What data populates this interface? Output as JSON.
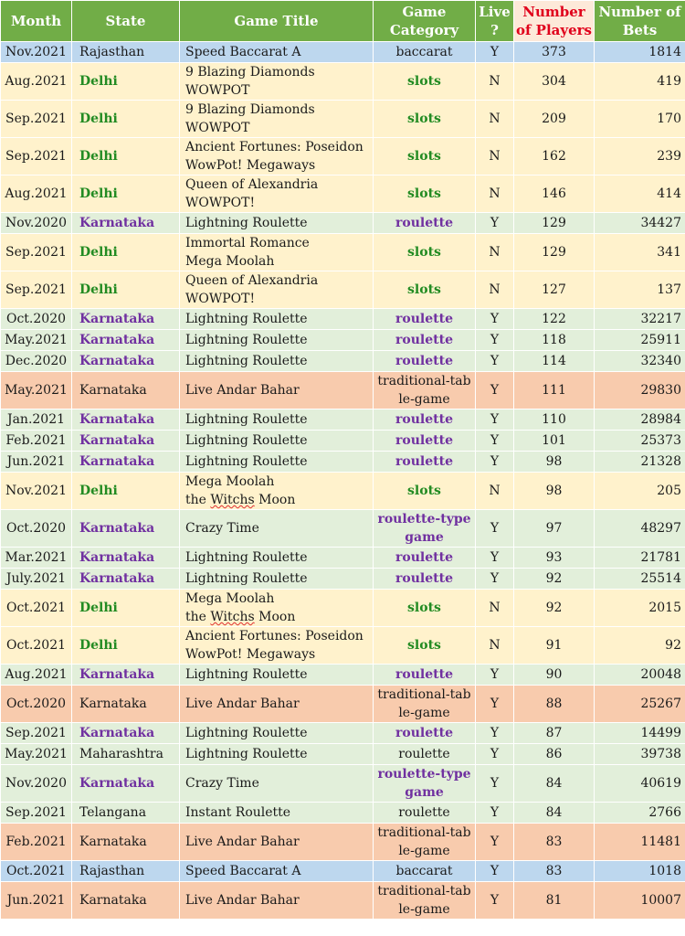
{
  "headers": {
    "month": "Month",
    "state": "State",
    "title": "Game Title",
    "category": "Game Category",
    "live": "Live ?",
    "players": "Number of Players",
    "bets": "Number of Bets"
  },
  "colors": {
    "header_bg": "#71ad47",
    "highlight_header_bg": "#fde9d9",
    "highlight_header_text": "#e0001b",
    "row_blue": "#bdd7ee",
    "row_yellow": "#fff2cc",
    "row_green": "#e2efda",
    "row_orange": "#f8cbad",
    "text_green": "#228b22",
    "text_purple": "#7030a0"
  },
  "rows": [
    {
      "month": "Nov.2021",
      "state": "Rajasthan",
      "title": [
        "Speed Baccarat A"
      ],
      "category": "baccarat",
      "live": "Y",
      "players": "373",
      "bets": "1814",
      "bg": "blue",
      "color": "plain"
    },
    {
      "month": "Aug.2021",
      "state": "Delhi",
      "title": [
        "9 Blazing Diamonds",
        "WOWPOT"
      ],
      "category": "slots",
      "live": "N",
      "players": "304",
      "bets": "419",
      "bg": "yellow",
      "color": "green"
    },
    {
      "month": "Sep.2021",
      "state": "Delhi",
      "title": [
        "9 Blazing Diamonds",
        "WOWPOT"
      ],
      "category": "slots",
      "live": "N",
      "players": "209",
      "bets": "170",
      "bg": "yellow",
      "color": "green"
    },
    {
      "month": "Sep.2021",
      "state": "Delhi",
      "title": [
        "Ancient Fortunes: Poseidon",
        "WowPot! Megaways"
      ],
      "category": "slots",
      "live": "N",
      "players": "162",
      "bets": "239",
      "bg": "yellow",
      "color": "green"
    },
    {
      "month": "Aug.2021",
      "state": "Delhi",
      "title": [
        "Queen of Alexandria",
        "WOWPOT!"
      ],
      "category": "slots",
      "live": "N",
      "players": "146",
      "bets": "414",
      "bg": "yellow",
      "color": "green"
    },
    {
      "month": "Nov.2020",
      "state": "Karnataka",
      "title": [
        "Lightning Roulette"
      ],
      "category": "roulette",
      "live": "Y",
      "players": "129",
      "bets": "34427",
      "bg": "green",
      "color": "purple"
    },
    {
      "month": "Sep.2021",
      "state": "Delhi",
      "title": [
        "Immortal Romance",
        "Mega Moolah"
      ],
      "category": "slots",
      "live": "N",
      "players": "129",
      "bets": "341",
      "bg": "yellow",
      "color": "green"
    },
    {
      "month": "Sep.2021",
      "state": "Delhi",
      "title": [
        "Queen of Alexandria",
        "WOWPOT!"
      ],
      "category": "slots",
      "live": "N",
      "players": "127",
      "bets": "137",
      "bg": "yellow",
      "color": "green"
    },
    {
      "month": "Oct.2020",
      "state": "Karnataka",
      "title": [
        "Lightning Roulette"
      ],
      "category": "roulette",
      "live": "Y",
      "players": "122",
      "bets": "32217",
      "bg": "green",
      "color": "purple"
    },
    {
      "month": "May.2021",
      "state": "Karnataka",
      "title": [
        "Lightning Roulette"
      ],
      "category": "roulette",
      "live": "Y",
      "players": "118",
      "bets": "25911",
      "bg": "green",
      "color": "purple"
    },
    {
      "month": "Dec.2020",
      "state": "Karnataka",
      "title": [
        "Lightning Roulette"
      ],
      "category": "roulette",
      "live": "Y",
      "players": "114",
      "bets": "32340",
      "bg": "green",
      "color": "purple"
    },
    {
      "month": "May.2021",
      "state": "Karnataka",
      "title": [
        "Live Andar Bahar"
      ],
      "category": "traditional-table-game",
      "live": "Y",
      "players": "111",
      "bets": "29830",
      "bg": "orange",
      "color": "plain"
    },
    {
      "month": "Jan.2021",
      "state": "Karnataka",
      "title": [
        "Lightning Roulette"
      ],
      "category": "roulette",
      "live": "Y",
      "players": "110",
      "bets": "28984",
      "bg": "green",
      "color": "purple"
    },
    {
      "month": "Feb.2021",
      "state": "Karnataka",
      "title": [
        "Lightning Roulette"
      ],
      "category": "roulette",
      "live": "Y",
      "players": "101",
      "bets": "25373",
      "bg": "green",
      "color": "purple"
    },
    {
      "month": "Jun.2021",
      "state": "Karnataka",
      "title": [
        "Lightning Roulette"
      ],
      "category": "roulette",
      "live": "Y",
      "players": "98",
      "bets": "21328",
      "bg": "green",
      "color": "purple"
    },
    {
      "month": "Nov.2021",
      "state": "Delhi",
      "title": [
        "Mega Moolah",
        "the Witchs Moon"
      ],
      "category": "slots",
      "live": "N",
      "players": "98",
      "bets": "205",
      "bg": "yellow",
      "color": "green"
    },
    {
      "month": "Oct.2020",
      "state": "Karnataka",
      "title": [
        "Crazy Time"
      ],
      "category": "roulette-type game",
      "live": "Y",
      "players": "97",
      "bets": "48297",
      "bg": "green",
      "color": "purple"
    },
    {
      "month": "Mar.2021",
      "state": "Karnataka",
      "title": [
        "Lightning Roulette"
      ],
      "category": "roulette",
      "live": "Y",
      "players": "93",
      "bets": "21781",
      "bg": "green",
      "color": "purple"
    },
    {
      "month": "July.2021",
      "state": "Karnataka",
      "title": [
        "Lightning Roulette"
      ],
      "category": "roulette",
      "live": "Y",
      "players": "92",
      "bets": "25514",
      "bg": "green",
      "color": "purple"
    },
    {
      "month": "Oct.2021",
      "state": "Delhi",
      "title": [
        "Mega Moolah",
        "the Witchs Moon"
      ],
      "category": "slots",
      "live": "N",
      "players": "92",
      "bets": "2015",
      "bg": "yellow",
      "color": "green"
    },
    {
      "month": "Oct.2021",
      "state": "Delhi",
      "title": [
        "Ancient Fortunes: Poseidon",
        "WowPot! Megaways"
      ],
      "category": "slots",
      "live": "N",
      "players": "91",
      "bets": "92",
      "bg": "yellow",
      "color": "green"
    },
    {
      "month": "Aug.2021",
      "state": "Karnataka",
      "title": [
        "Lightning Roulette"
      ],
      "category": "roulette",
      "live": "Y",
      "players": "90",
      "bets": "20048",
      "bg": "green",
      "color": "purple"
    },
    {
      "month": "Oct.2020",
      "state": "Karnataka",
      "title": [
        "Live Andar Bahar"
      ],
      "category": "traditional-table-game",
      "live": "Y",
      "players": "88",
      "bets": "25267",
      "bg": "orange",
      "color": "plain"
    },
    {
      "month": "Sep.2021",
      "state": "Karnataka",
      "title": [
        "Lightning Roulette"
      ],
      "category": "roulette",
      "live": "Y",
      "players": "87",
      "bets": "14499",
      "bg": "green",
      "color": "purple"
    },
    {
      "month": "May.2021",
      "state": "Maharashtra",
      "title": [
        "Lightning Roulette"
      ],
      "category": "roulette",
      "live": "Y",
      "players": "86",
      "bets": "39738",
      "bg": "green",
      "color": "plain"
    },
    {
      "month": "Nov.2020",
      "state": "Karnataka",
      "title": [
        "Crazy Time"
      ],
      "category": "roulette-type game",
      "live": "Y",
      "players": "84",
      "bets": "40619",
      "bg": "green",
      "color": "purple"
    },
    {
      "month": "Sep.2021",
      "state": "Telangana",
      "title": [
        "Instant Roulette"
      ],
      "category": "roulette",
      "live": "Y",
      "players": "84",
      "bets": "2766",
      "bg": "green",
      "color": "plain"
    },
    {
      "month": "Feb.2021",
      "state": "Karnataka",
      "title": [
        "Live Andar Bahar"
      ],
      "category": "traditional-table-game",
      "live": "Y",
      "players": "83",
      "bets": "11481",
      "bg": "orange",
      "color": "plain"
    },
    {
      "month": "Oct.2021",
      "state": "Rajasthan",
      "title": [
        "Speed Baccarat A"
      ],
      "category": "baccarat",
      "live": "Y",
      "players": "83",
      "bets": "1018",
      "bg": "blue",
      "color": "plain"
    },
    {
      "month": "Jun.2021",
      "state": "Karnataka",
      "title": [
        "Live Andar Bahar"
      ],
      "category": "traditional-table-game",
      "live": "Y",
      "players": "81",
      "bets": "10007",
      "bg": "orange",
      "color": "plain"
    }
  ]
}
